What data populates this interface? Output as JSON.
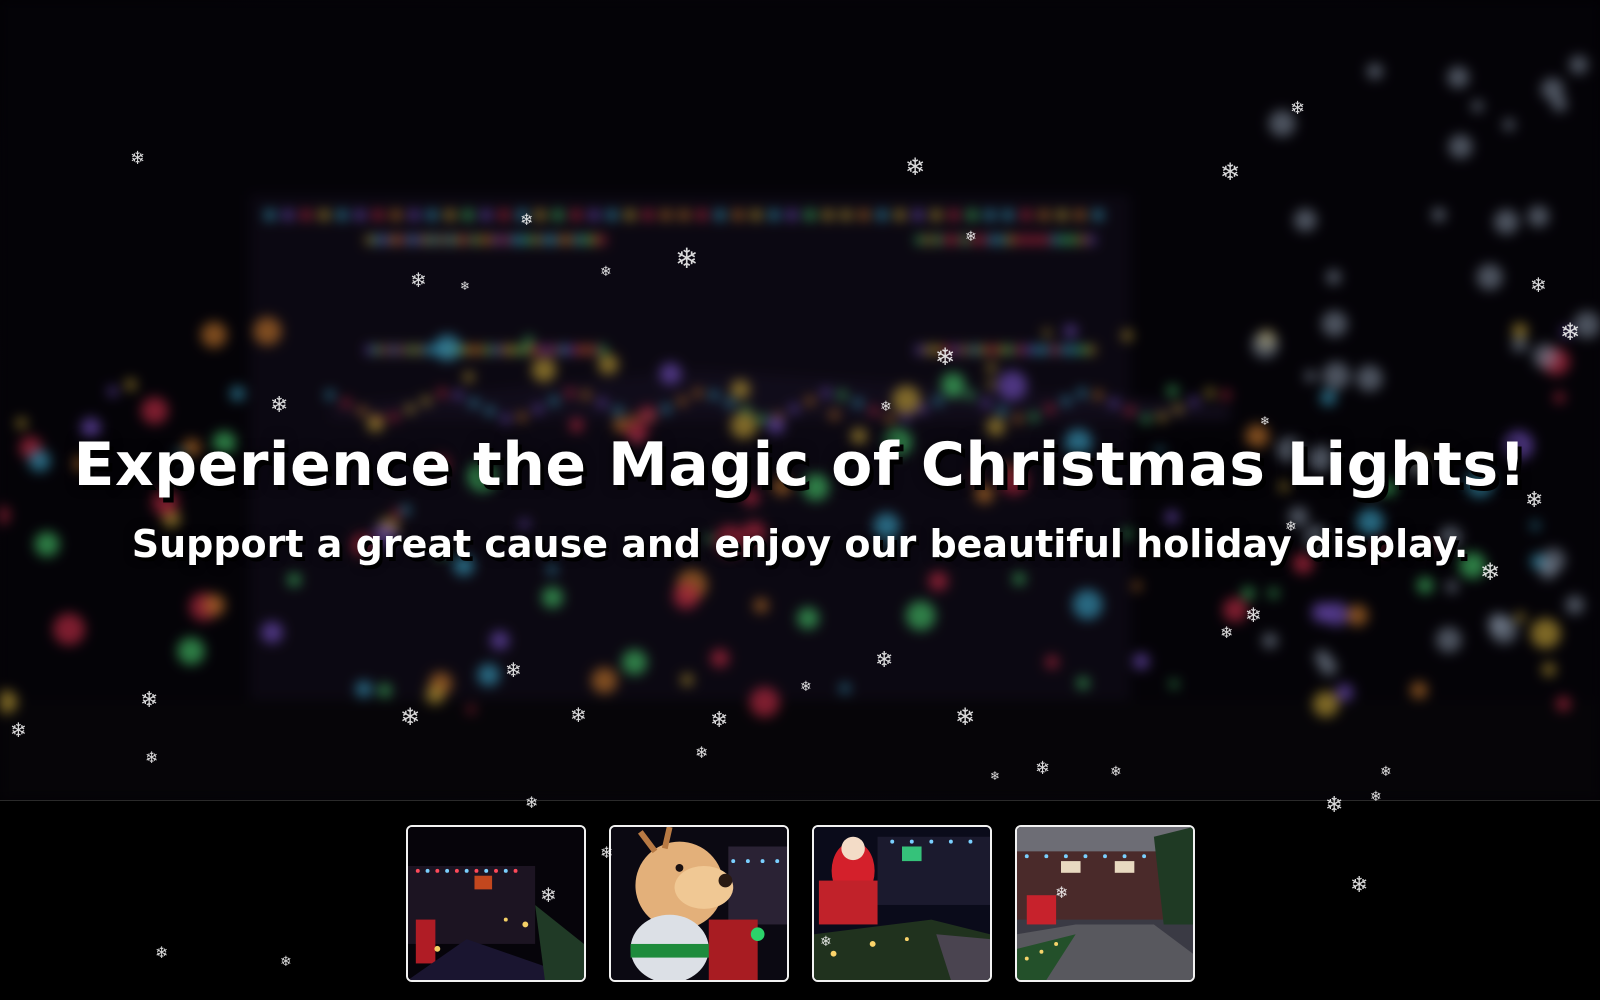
{
  "hero": {
    "title": "Experience the Magic of Christmas Lights!",
    "subtitle": "Support a great cause and enjoy our beautiful holiday display."
  },
  "gallery": {
    "thumbnails": [
      {
        "name": "house-lights-night"
      },
      {
        "name": "inflatable-reindeer"
      },
      {
        "name": "inflatable-santa-yard"
      },
      {
        "name": "house-driveway-dusk"
      }
    ]
  },
  "icons": {
    "snowflake": "snowflake-icon"
  },
  "colors": {
    "background": "#000000",
    "thumbnail_border": "#f2f2f2",
    "text": "#ffffff"
  }
}
